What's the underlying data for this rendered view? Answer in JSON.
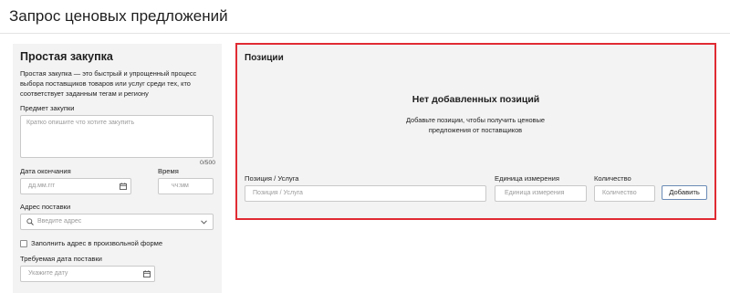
{
  "header": {
    "title": "Запрос ценовых предложений"
  },
  "simple_purchase": {
    "title": "Простая закупка",
    "description": "Простая закупка — это быстрый и упрощенный процесс выбора поставщиков товаров или услуг среди тех, кто соответствует заданным тегам и региону",
    "subject": {
      "label": "Предмет закупки",
      "placeholder": "Кратко опишите что хотите закупить",
      "counter": "0/500"
    },
    "end_date": {
      "label": "Дата окончания",
      "placeholder": "дд.мм.ггг",
      "icon": "calendar-icon"
    },
    "time": {
      "label": "Время",
      "placeholder": "чч:мм"
    },
    "address": {
      "label": "Адрес поставки",
      "placeholder": "Введите адрес",
      "icon": "search-icon",
      "dropdown_icon": "chevron-down-icon"
    },
    "free_form": {
      "label": "Заполнить адрес в произвольной форме",
      "checked": false
    },
    "delivery_date": {
      "label": "Требуемая дата поставки",
      "placeholder": "Укажите дату",
      "icon": "calendar-icon"
    }
  },
  "positions": {
    "title": "Позиции",
    "empty_title": "Нет добавленных позиций",
    "empty_desc": "Добавьте позиции, чтобы получить ценовые предложения от поставщиков",
    "item": {
      "label": "Позиция / Услуга",
      "placeholder": "Позиция / Услуга"
    },
    "unit": {
      "label": "Единица измерения",
      "placeholder": "Единица измерения"
    },
    "quantity": {
      "label": "Количество",
      "placeholder": "Количество"
    },
    "add_button": "Добавить",
    "highlight_color": "#e02b33"
  }
}
